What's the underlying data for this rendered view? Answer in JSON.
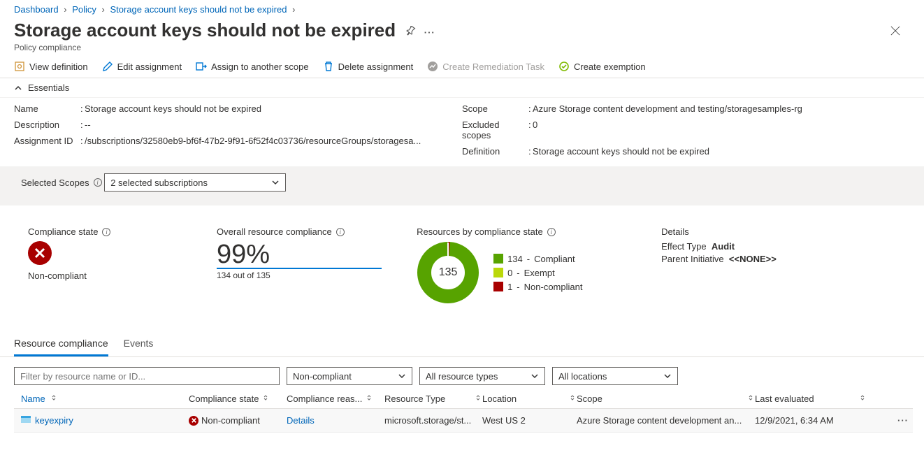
{
  "breadcrumb": {
    "items": [
      "Dashboard",
      "Policy",
      "Storage account keys should not be expired"
    ]
  },
  "header": {
    "title": "Storage account keys should not be expired",
    "subtitle": "Policy compliance"
  },
  "toolbar": {
    "view_def": "View definition",
    "edit_assign": "Edit assignment",
    "assign_scope": "Assign to another scope",
    "delete_assign": "Delete assignment",
    "create_remediation": "Create Remediation Task",
    "create_exemption": "Create exemption"
  },
  "essentials": {
    "label": "Essentials",
    "left": {
      "name_label": "Name",
      "name_value": "Storage account keys should not be expired",
      "desc_label": "Description",
      "desc_value": "--",
      "assign_id_label": "Assignment ID",
      "assign_id_value": "/subscriptions/32580eb9-bf6f-47b2-9f91-6f52f4c03736/resourceGroups/storagesa..."
    },
    "right": {
      "scope_label": "Scope",
      "scope_value": "Azure Storage content development and testing/storagesamples-rg",
      "excl_label": "Excluded scopes",
      "excl_value": "0",
      "def_label": "Definition",
      "def_value": "Storage account keys should not be expired"
    }
  },
  "selected_scopes": {
    "label": "Selected Scopes",
    "value": "2 selected subscriptions"
  },
  "metrics": {
    "compliance_state": {
      "title": "Compliance state",
      "value": "Non-compliant"
    },
    "overall": {
      "title": "Overall resource compliance",
      "percent": "99%",
      "sub": "134 out of 135"
    },
    "by_state": {
      "title": "Resources by compliance state",
      "center": "135",
      "compliant": {
        "count": "134",
        "label": "Compliant",
        "color": "#57a300"
      },
      "exempt": {
        "count": "0",
        "label": "Exempt",
        "color": "#bad80a"
      },
      "noncompliant": {
        "count": "1",
        "label": "Non-compliant",
        "color": "#a80000"
      }
    },
    "details": {
      "title": "Details",
      "effect_label": "Effect Type",
      "effect_value": "Audit",
      "parent_label": "Parent Initiative",
      "parent_value": "<<NONE>>"
    }
  },
  "tabs": {
    "resource": "Resource compliance",
    "events": "Events"
  },
  "filters": {
    "placeholder": "Filter by resource name or ID...",
    "compliance": "Non-compliant",
    "types": "All resource types",
    "locations": "All locations"
  },
  "table": {
    "headers": {
      "name": "Name",
      "state": "Compliance state",
      "reason": "Compliance reas...",
      "type": "Resource Type",
      "loc": "Location",
      "scope": "Scope",
      "eval": "Last evaluated"
    },
    "row": {
      "name": "keyexpiry",
      "state": "Non-compliant",
      "reason": "Details",
      "type": "microsoft.storage/st...",
      "loc": "West US 2",
      "scope": "Azure Storage content development an...",
      "eval": "12/9/2021, 6:34 AM"
    }
  },
  "chart_data": {
    "type": "pie",
    "title": "Resources by compliance state",
    "series": [
      {
        "name": "Compliant",
        "value": 134,
        "color": "#57a300"
      },
      {
        "name": "Exempt",
        "value": 0,
        "color": "#bad80a"
      },
      {
        "name": "Non-compliant",
        "value": 1,
        "color": "#a80000"
      }
    ],
    "total": 135
  }
}
